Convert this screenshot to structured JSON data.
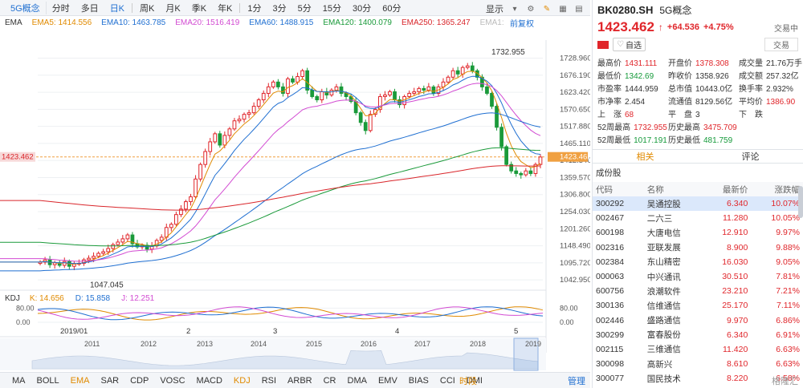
{
  "toolbar": {
    "tab_label": "5G概念",
    "items": [
      "分时",
      "多日",
      "日K",
      "周K",
      "月K",
      "季K",
      "年K",
      "1分",
      "3分",
      "5分",
      "15分",
      "30分",
      "60分"
    ],
    "active_index": 2,
    "display_label": "显示"
  },
  "indicators": {
    "ema_title": "EMA",
    "ema_values": [
      {
        "label": "EMA5: 1414.556",
        "color": "#e08a00"
      },
      {
        "label": "EMA10: 1463.785",
        "color": "#1f6fd1"
      },
      {
        "label": "EMA20: 1516.419",
        "color": "#d24bd2"
      },
      {
        "label": "EMA60: 1488.915",
        "color": "#1f6fd1"
      },
      {
        "label": "EMA120: 1400.079",
        "color": "#1a9a3a"
      },
      {
        "label": "EMA250: 1365.247",
        "color": "#d9262b"
      },
      {
        "label": "EMA1:",
        "color": "#bbbbbb"
      }
    ],
    "adjust_label": "前复权",
    "kdj_title": "KDJ",
    "kdj_values": [
      {
        "label": "K: 14.656",
        "color": "#e08a00"
      },
      {
        "label": "D: 15.858",
        "color": "#1f6fd1"
      },
      {
        "label": "J: 12.251",
        "color": "#d24bd2"
      }
    ]
  },
  "chart_data": {
    "type": "candlestick",
    "price_axis_ticks": [
      "1728.960",
      "1676.190",
      "1623.420",
      "1570.650",
      "1517.880",
      "1465.110",
      "1412.340",
      "1359.570",
      "1306.800",
      "1254.030",
      "1201.260",
      "1148.490",
      "1095.720",
      "1042.950"
    ],
    "price_range": [
      1016,
      1760
    ],
    "current_price": "1423.462",
    "high_label": "1732.955",
    "low_label": "1047.045",
    "kdj_ticks": [
      "80.00",
      "0.00"
    ],
    "x_labels_top": [
      "2019/01",
      "2",
      "3",
      "4",
      "5"
    ],
    "x_labels_bottom": [
      "2011",
      "2012",
      "2013",
      "2014",
      "2015",
      "2016",
      "2017",
      "2018",
      "2019"
    ],
    "closes": [
      1098,
      1105,
      1090,
      1096,
      1088,
      1100,
      1085,
      1092,
      1094,
      1105,
      1110,
      1116,
      1125,
      1130,
      1140,
      1152,
      1160,
      1170,
      1182,
      1155,
      1145,
      1150,
      1138,
      1148,
      1165,
      1175,
      1205,
      1215,
      1245,
      1262,
      1285,
      1300,
      1355,
      1400,
      1440,
      1470,
      1495,
      1460,
      1490,
      1510,
      1535,
      1540,
      1555,
      1560,
      1580,
      1600,
      1620,
      1640,
      1655,
      1640,
      1620,
      1665,
      1655,
      1672,
      1690,
      1630,
      1610,
      1600,
      1625,
      1615,
      1630,
      1640,
      1620,
      1610,
      1595,
      1560,
      1530,
      1505,
      1555,
      1570,
      1610,
      1615,
      1625,
      1600,
      1585,
      1610,
      1620,
      1625,
      1635,
      1630,
      1640,
      1620,
      1640,
      1655,
      1670,
      1690,
      1680,
      1700,
      1705,
      1690,
      1670,
      1640,
      1620,
      1580,
      1515,
      1455,
      1400,
      1380,
      1372,
      1368,
      1380,
      1372,
      1400,
      1423
    ]
  },
  "right_panel": {
    "code": "BK0280.SH",
    "name": "5G概念",
    "status": "交易中",
    "price": "1423.462",
    "change": "+64.536",
    "change_pct": "+4.75%",
    "watch_label": "自选",
    "trade_label": "交易",
    "stats": [
      {
        "label": "最高价",
        "value": "1431.111",
        "cls": "red"
      },
      {
        "label": "开盘价",
        "value": "1378.308",
        "cls": "red"
      },
      {
        "label": "成交量",
        "value": "21.76万手",
        "cls": ""
      },
      {
        "label": "最低价",
        "value": "1342.69",
        "cls": "green"
      },
      {
        "label": "昨收价",
        "value": "1358.926",
        "cls": ""
      },
      {
        "label": "成交额",
        "value": "257.32亿",
        "cls": ""
      },
      {
        "label": "市盈率",
        "value": "1444.959",
        "cls": ""
      },
      {
        "label": "总市值",
        "value": "10443.0亿",
        "cls": ""
      },
      {
        "label": "换手率",
        "value": "2.932%",
        "cls": ""
      },
      {
        "label": "市净率",
        "value": "2.454",
        "cls": ""
      },
      {
        "label": "流通值",
        "value": "8129.56亿",
        "cls": ""
      },
      {
        "label": "平均价",
        "value": "1386.90",
        "cls": "red"
      },
      {
        "label": "上　涨",
        "value": "68",
        "cls": "red"
      },
      {
        "label": "平　盘",
        "value": "3",
        "cls": ""
      },
      {
        "label": "下　跌",
        "value": "",
        "cls": "green"
      },
      {
        "label": "52周最高",
        "value": "1732.955",
        "cls": "red"
      },
      {
        "label": "历史最高",
        "value": "3475.709",
        "cls": "red"
      },
      {
        "label": "",
        "value": "",
        "cls": ""
      },
      {
        "label": "52周最低",
        "value": "1017.191",
        "cls": "green"
      },
      {
        "label": "历史最低",
        "value": "481.759",
        "cls": "green"
      },
      {
        "label": "",
        "value": "",
        "cls": ""
      }
    ],
    "tabs": [
      "相关",
      "评论"
    ],
    "section_title": "成份股",
    "table_headers": [
      "代码",
      "名称",
      "最新价",
      "涨跌幅"
    ],
    "rows": [
      {
        "code": "300292",
        "name": "吴通控股",
        "price": "6.340",
        "pct": "10.07%"
      },
      {
        "code": "002467",
        "name": "二六三",
        "price": "11.280",
        "pct": "10.05%"
      },
      {
        "code": "600198",
        "name": "大唐电信",
        "price": "12.910",
        "pct": "9.97%"
      },
      {
        "code": "002316",
        "name": "亚联发展",
        "price": "8.900",
        "pct": "9.88%"
      },
      {
        "code": "002384",
        "name": "东山精密",
        "price": "16.030",
        "pct": "9.05%"
      },
      {
        "code": "000063",
        "name": "中兴通讯",
        "price": "30.510",
        "pct": "7.81%"
      },
      {
        "code": "600756",
        "name": "浪潮软件",
        "price": "23.210",
        "pct": "7.21%"
      },
      {
        "code": "300136",
        "name": "信维通信",
        "price": "25.170",
        "pct": "7.11%"
      },
      {
        "code": "002446",
        "name": "盛路通信",
        "price": "9.970",
        "pct": "6.86%"
      },
      {
        "code": "300299",
        "name": "富春股份",
        "price": "6.340",
        "pct": "6.91%"
      },
      {
        "code": "002115",
        "name": "三维通信",
        "price": "11.420",
        "pct": "6.63%"
      },
      {
        "code": "300098",
        "name": "高新兴",
        "price": "8.610",
        "pct": "6.63%"
      },
      {
        "code": "300077",
        "name": "国民技术",
        "price": "8.220",
        "pct": "6.58%"
      }
    ],
    "watermark": "格隆汇"
  },
  "bottom_tabs": {
    "items": [
      "MA",
      "BOLL",
      "EMA",
      "SAR",
      "CDP",
      "VOSC",
      "MACD",
      "KDJ",
      "RSI",
      "ARBR",
      "CR",
      "DMA",
      "EMV",
      "BIAS",
      "CCI",
      "DMI"
    ],
    "highlight": [
      "EMA",
      "KDJ"
    ],
    "period_label": "时段",
    "manage_label": "管理"
  }
}
